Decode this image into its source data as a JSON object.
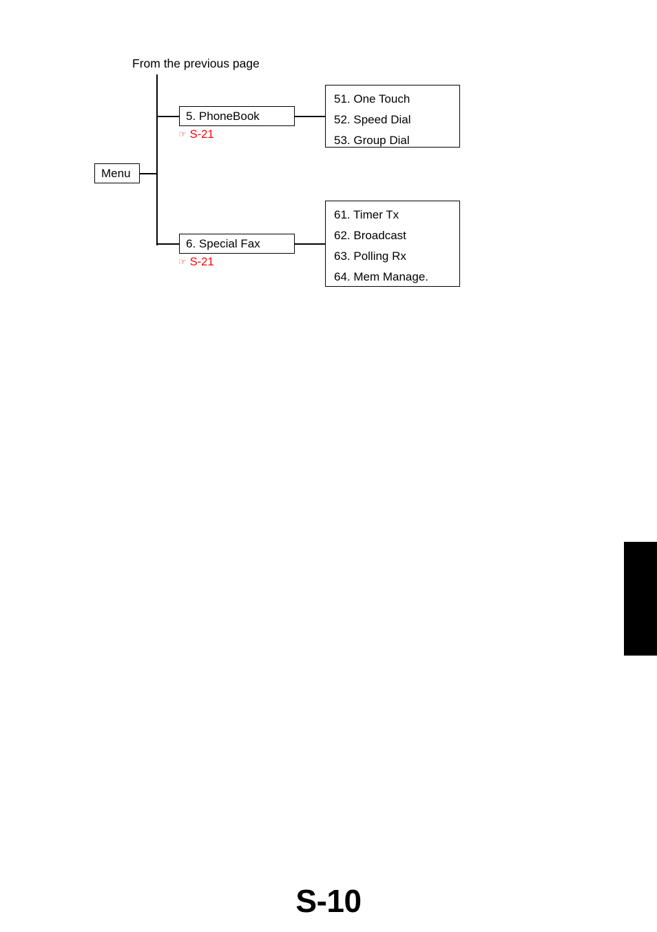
{
  "page": {
    "number_label": "S-10",
    "entry_note": "From the previous page"
  },
  "diagram": {
    "root": {
      "label": "Menu"
    },
    "branches": [
      {
        "label": "5. PhoneBook",
        "xref": {
          "icon": "pointing-hand-icon",
          "icon_glyph": "☞",
          "label": "S-21",
          "color": "#ff0000"
        },
        "items": [
          "51. One Touch",
          "52. Speed Dial",
          "53. Group Dial"
        ]
      },
      {
        "label": "6. Special Fax",
        "xref": {
          "icon": "pointing-hand-icon",
          "icon_glyph": "☞",
          "label": "S-21",
          "color": "#ff0000"
        },
        "items": [
          "61. Timer Tx",
          "62. Broadcast",
          "63. Polling Rx",
          "64. Mem Manage."
        ]
      }
    ]
  },
  "colors": {
    "line": "#000000",
    "text": "#000000",
    "accent_red": "#ff0000",
    "background": "#ffffff"
  }
}
